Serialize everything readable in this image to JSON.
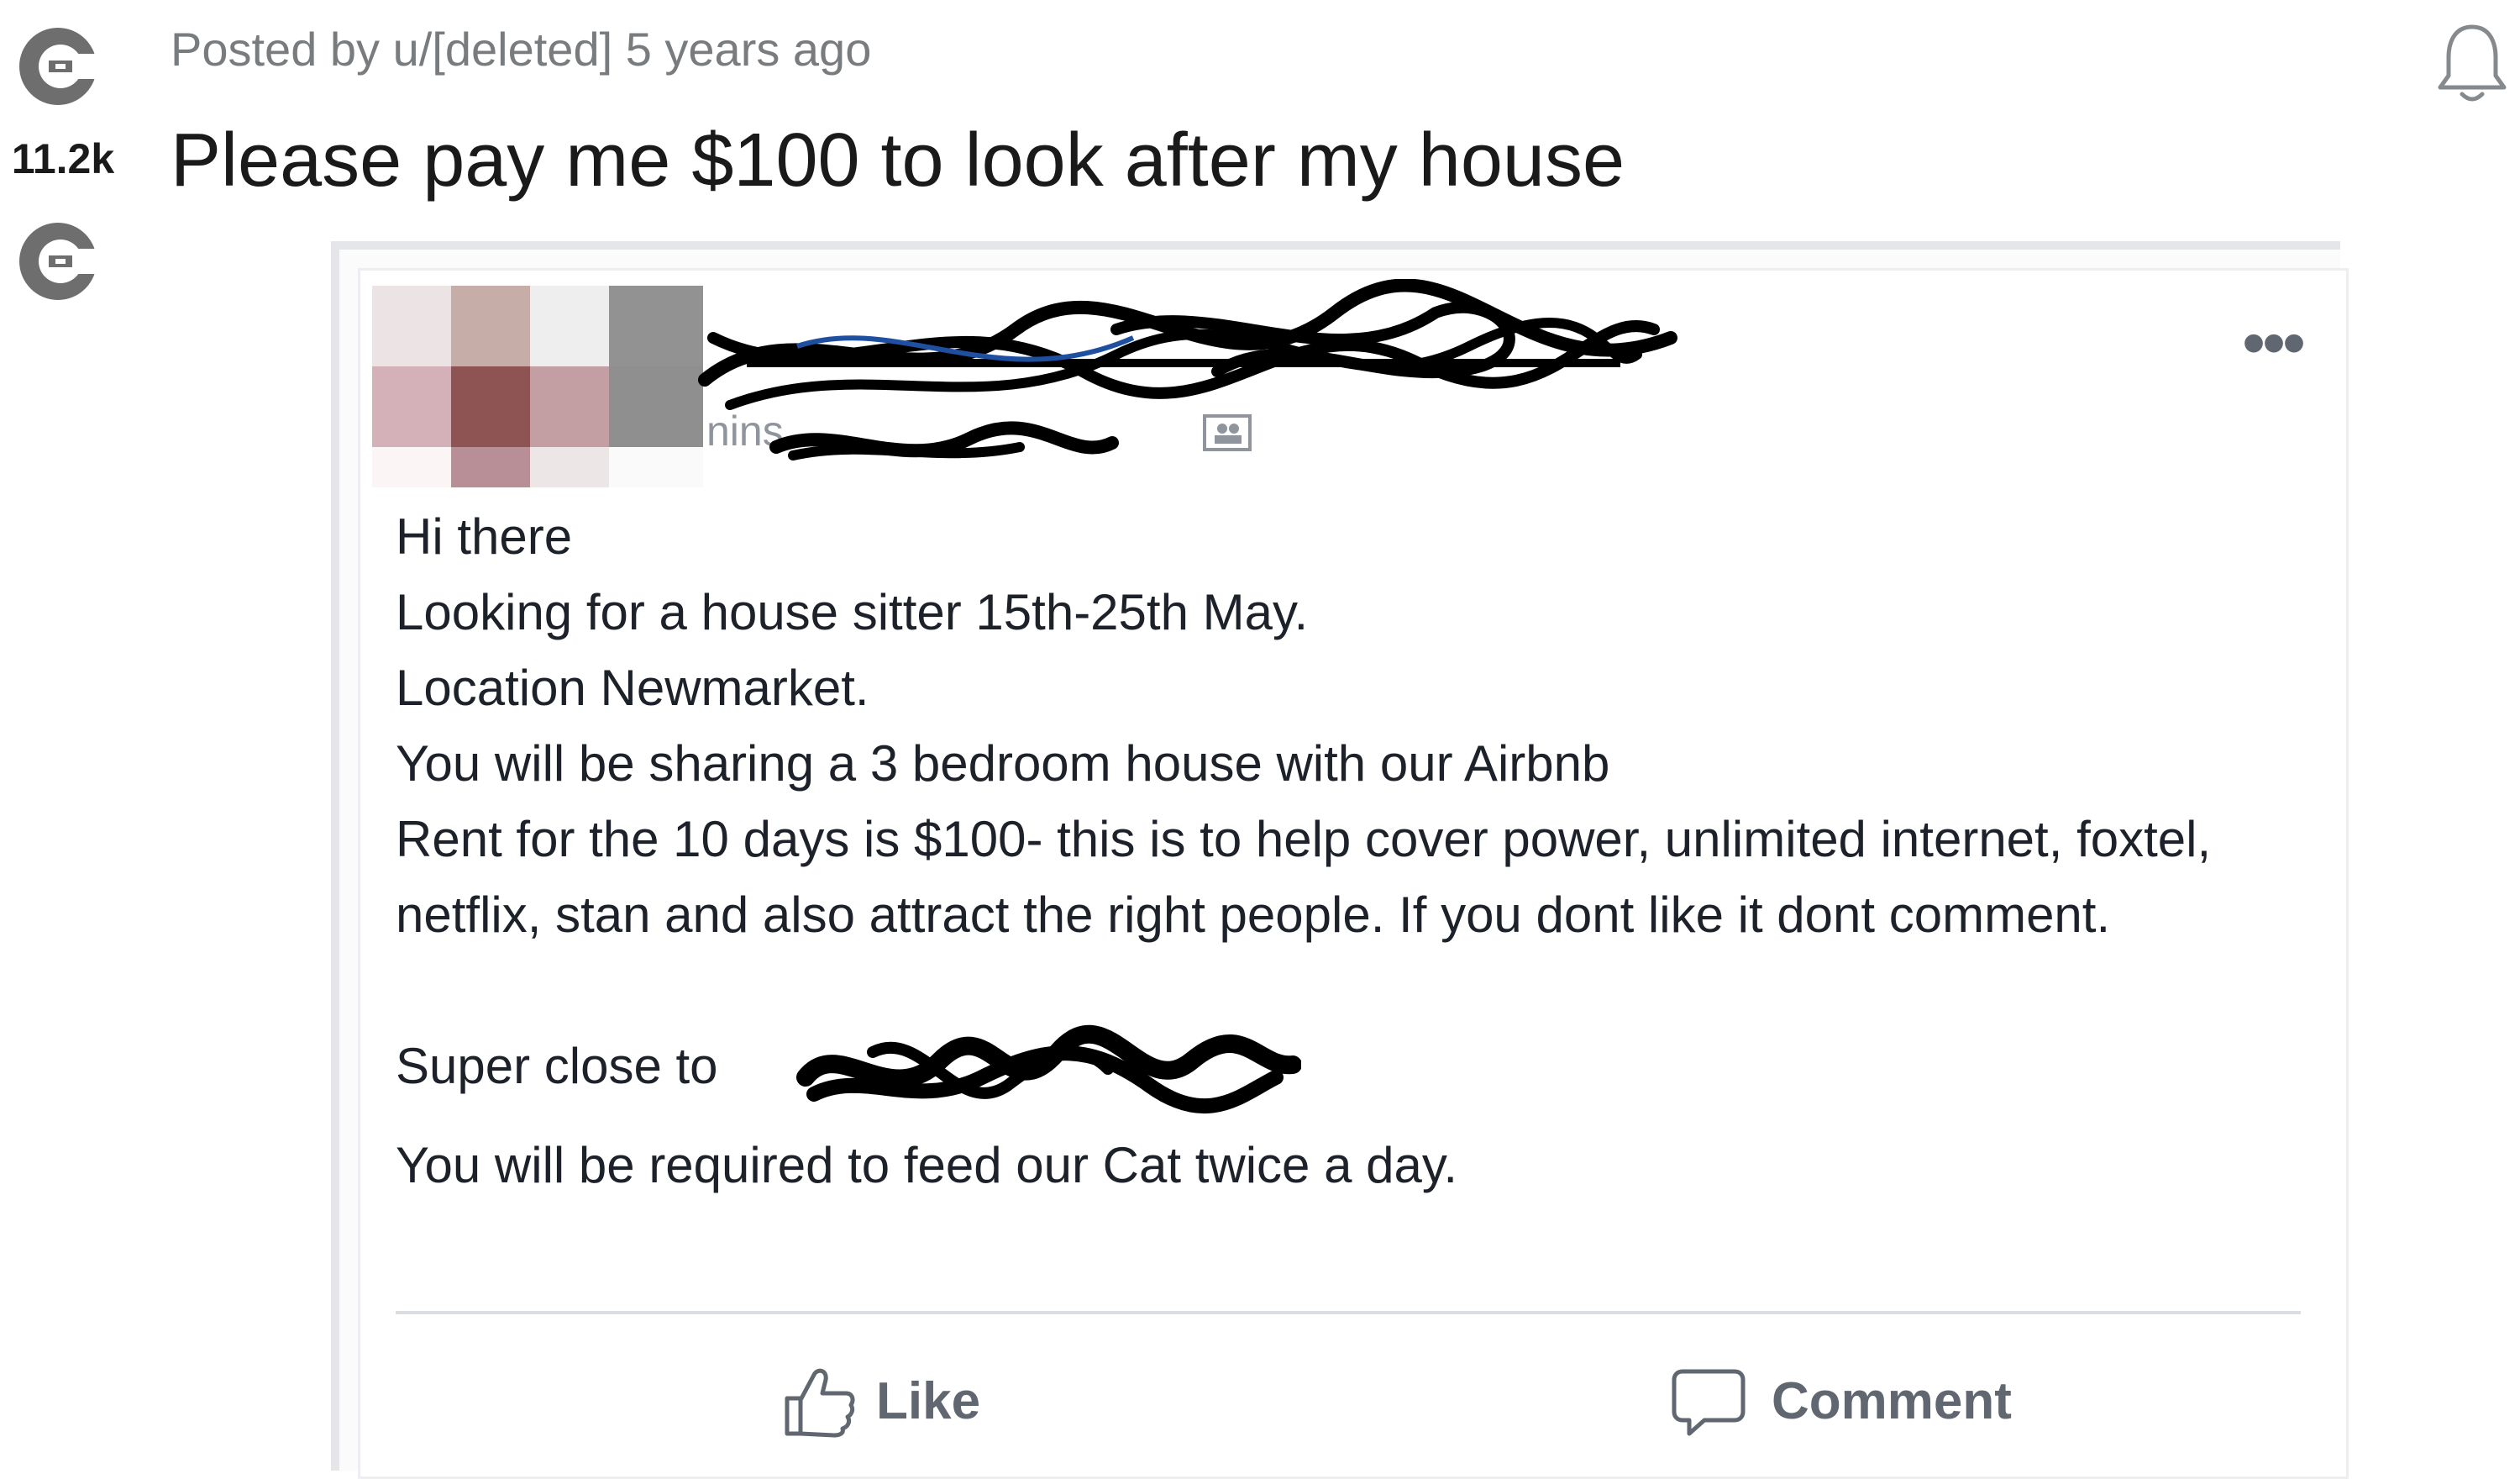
{
  "post": {
    "meta": "Posted by u/[deleted] 5 years ago",
    "score": "11.2k",
    "title": "Please pay me $100 to look after my house",
    "upvote_icon": "upvote-icon",
    "downvote_icon": "downvote-icon",
    "notification_icon": "bell-icon"
  },
  "screenshot": {
    "timestamp_partial": "nins",
    "more_options": "•••",
    "body_lines": [
      "Hi there",
      "Looking for a house sitter 15th-25th May.",
      "Location Newmarket.",
      "You will be sharing a 3 bedroom house with our Airbnb",
      "Rent for the 10 days is $100- this is to help cover power, unlimited internet, foxtel, netflix, stan and also attract the right people. If you dont like it dont comment.",
      "Super close to",
      "You will be required to feed our Cat twice a day."
    ],
    "actions": {
      "like": "Like",
      "comment": "Comment"
    }
  },
  "colors": {
    "meta": "#787c7e",
    "title": "#1a1a1b",
    "fb_text": "#1d2129",
    "fb_action": "#606770"
  }
}
